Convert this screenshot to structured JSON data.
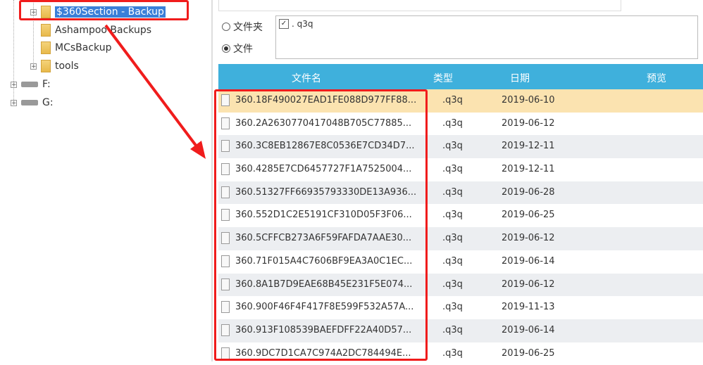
{
  "tree": {
    "items": [
      {
        "label": "$360Section - Backup",
        "selected": true,
        "expandable": true
      },
      {
        "label": "Ashampoo Backups",
        "expandable": false
      },
      {
        "label": "MCsBackup",
        "expandable": false
      },
      {
        "label": "tools",
        "expandable": true
      }
    ],
    "drives": [
      "F:",
      "G:"
    ]
  },
  "options": {
    "folder_label": "文件夹",
    "file_label": "文件",
    "selected": "文件"
  },
  "filter": {
    "extension": ". q3q",
    "checked": true
  },
  "table": {
    "headers": [
      "文件名",
      "类型",
      "日期",
      "预览"
    ],
    "rows": [
      {
        "name": "360.18F490027EAD1FE088D977FF88...",
        "type": ".q3q",
        "date": "2019-06-10"
      },
      {
        "name": "360.2A2630770417048B705C77885...",
        "type": ".q3q",
        "date": "2019-06-12"
      },
      {
        "name": "360.3C8EB12867E8C0536E7CD34D7...",
        "type": ".q3q",
        "date": "2019-12-11"
      },
      {
        "name": "360.4285E7CD6457727F1A7525004...",
        "type": ".q3q",
        "date": "2019-12-11"
      },
      {
        "name": "360.51327FF66935793330DE13A936...",
        "type": ".q3q",
        "date": "2019-06-28"
      },
      {
        "name": "360.552D1C2E5191CF310D05F3F06...",
        "type": ".q3q",
        "date": "2019-06-25"
      },
      {
        "name": "360.5CFFCB273A6F59FAFDA7AAE30...",
        "type": ".q3q",
        "date": "2019-06-12"
      },
      {
        "name": "360.71F015A4C7606BF9EA3A0C1EC...",
        "type": ".q3q",
        "date": "2019-06-14"
      },
      {
        "name": "360.8A1B7D9EAE68B45E231F5E074...",
        "type": ".q3q",
        "date": "2019-06-12"
      },
      {
        "name": "360.900F46F4F417F8E599F532A57A...",
        "type": ".q3q",
        "date": "2019-11-13"
      },
      {
        "name": "360.913F108539BAEFDFF22A40D57...",
        "type": ".q3q",
        "date": "2019-06-14"
      },
      {
        "name": "360.9DC7D1CA7C974A2DC784494E...",
        "type": ".q3q",
        "date": "2019-06-25"
      }
    ]
  },
  "colors": {
    "header": "#3fb0dc",
    "highlight": "#fbe3b0",
    "annotation": "#f01c1c"
  }
}
